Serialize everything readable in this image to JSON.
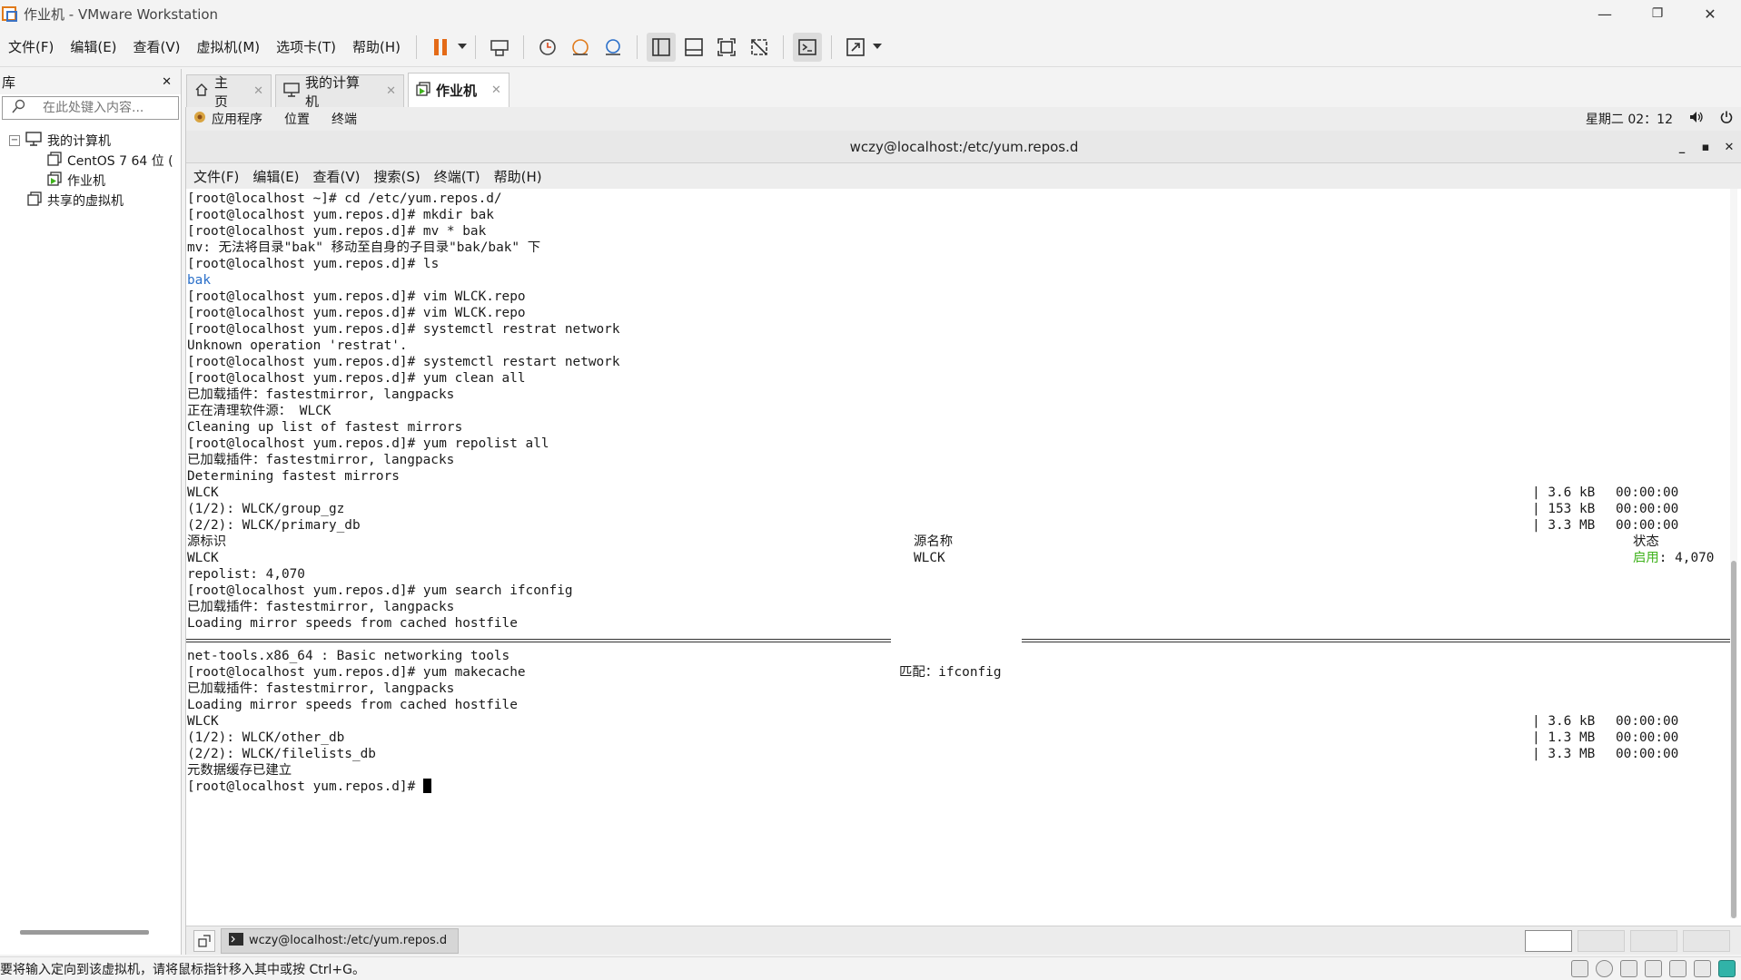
{
  "window": {
    "title": "作业机 - VMware Workstation",
    "min": "—",
    "restore": "❐",
    "close": "✕"
  },
  "menu": [
    "文件(F)",
    "编辑(E)",
    "查看(V)",
    "虚拟机(M)",
    "选项卡(T)",
    "帮助(H)"
  ],
  "library": {
    "title": "库",
    "close": "✕",
    "search_placeholder": "在此处键入内容...",
    "tree": {
      "root": "我的计算机",
      "toggle": "−",
      "children": [
        "CentOS 7 64 位 (",
        "作业机"
      ],
      "shared": "共享的虚拟机"
    }
  },
  "tabs": [
    {
      "label": "主页",
      "close": "✕"
    },
    {
      "label": "我的计算机",
      "close": "✕"
    },
    {
      "label": "作业机",
      "close": "✕"
    }
  ],
  "gnome": {
    "apps": "应用程序",
    "places": "位置",
    "terminal": "终端",
    "clock": "星期二 02：12"
  },
  "terminal": {
    "title": "wczy@localhost:/etc/yum.repos.d",
    "menu": [
      "文件(F)",
      "编辑(E)",
      "查看(V)",
      "搜索(S)",
      "终端(T)",
      "帮助(H)"
    ],
    "lines": [
      "[root@localhost ~]# cd /etc/yum.repos.d/",
      "[root@localhost yum.repos.d]# mkdir bak",
      "[root@localhost yum.repos.d]# mv * bak",
      "mv: 无法将目录\"bak\" 移动至自身的子目录\"bak/bak\" 下",
      "[root@localhost yum.repos.d]# ls",
      "bak",
      "[root@localhost yum.repos.d]# vim WLCK.repo",
      "[root@localhost yum.repos.d]# vim WLCK.repo",
      "[root@localhost yum.repos.d]# systemctl restrat network",
      "Unknown operation 'restrat'.",
      "[root@localhost yum.repos.d]# systemctl restart network",
      "[root@localhost yum.repos.d]# yum clean all",
      "已加载插件：fastestmirror, langpacks",
      "正在清理软件源： WLCK",
      "Cleaning up list of fastest mirrors",
      "[root@localhost yum.repos.d]# yum repolist all",
      "已加载插件：fastestmirror, langpacks",
      "Determining fastest mirrors"
    ],
    "dl1": [
      {
        "name": "WLCK",
        "size": "| 3.6 kB",
        "time": "00:00:00"
      },
      {
        "name": "(1/2): WLCK/group_gz",
        "size": "| 153 kB",
        "time": "00:00:00"
      },
      {
        "name": "(2/2): WLCK/primary_db",
        "size": "| 3.3 MB",
        "time": "00:00:00"
      }
    ],
    "repo_header": {
      "id": "源标识",
      "name": "源名称",
      "status": "状态"
    },
    "repo_row": {
      "id": "WLCK",
      "name": "WLCK",
      "status_word": "启用",
      "count": ": 4,070"
    },
    "lines2": [
      "repolist: 4,070",
      "[root@localhost yum.repos.d]# yum search ifconfig",
      "已加载插件：fastestmirror, langpacks",
      "Loading mirror speeds from cached hostfile"
    ],
    "match_label": "匹配：ifconfig",
    "lines3": [
      "net-tools.x86_64 : Basic networking tools",
      "[root@localhost yum.repos.d]# yum makecache",
      "已加载插件：fastestmirror, langpacks",
      "Loading mirror speeds from cached hostfile"
    ],
    "dl2": [
      {
        "name": "WLCK",
        "size": "| 3.6 kB",
        "time": "00:00:00"
      },
      {
        "name": "(1/2): WLCK/other_db",
        "size": "| 1.3 MB",
        "time": "00:00:00"
      },
      {
        "name": "(2/2): WLCK/filelists_db",
        "size": "| 3.3 MB",
        "time": "00:00:00"
      }
    ],
    "lines4": [
      "元数据缓存已建立"
    ],
    "prompt": "[root@localhost yum.repos.d]# "
  },
  "taskbar": {
    "item": "wczy@localhost:/etc/yum.repos.d"
  },
  "status": {
    "text": "要将输入定向到该虚拟机，请将鼠标指针移入其中或按 Ctrl+G。"
  }
}
